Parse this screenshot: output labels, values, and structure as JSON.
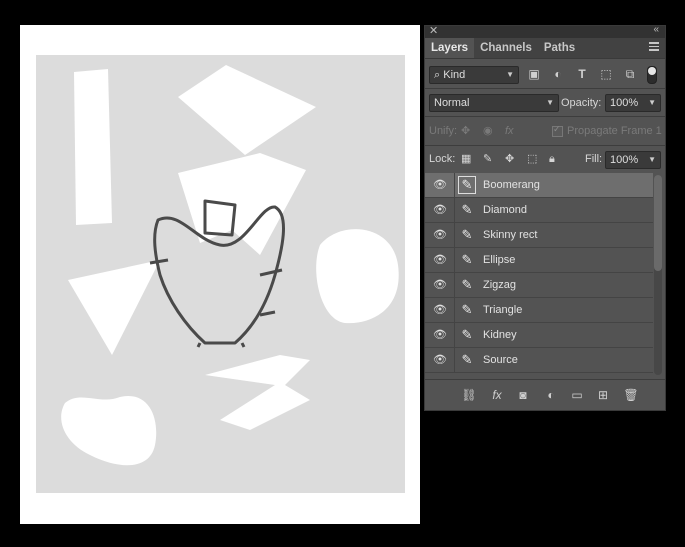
{
  "panel": {
    "tabs": [
      "Layers",
      "Channels",
      "Paths"
    ],
    "active_tab": "Layers",
    "filter": {
      "kind_label": "Kind"
    },
    "blend_mode": "Normal",
    "opacity_label": "Opacity:",
    "opacity_value": "100%",
    "unify_label": "Unify:",
    "propagate_label": "Propagate Frame 1",
    "lock_label": "Lock:",
    "fill_label": "Fill:",
    "fill_value": "100%",
    "layers": [
      {
        "name": "Boomerang",
        "selected": true
      },
      {
        "name": "Diamond",
        "selected": false
      },
      {
        "name": "Skinny rect",
        "selected": false
      },
      {
        "name": "Ellipse",
        "selected": false
      },
      {
        "name": "Zigzag",
        "selected": false
      },
      {
        "name": "Triangle",
        "selected": false
      },
      {
        "name": "Kidney",
        "selected": false
      },
      {
        "name": "Source",
        "selected": false
      }
    ],
    "bottom_icons": [
      "link-icon",
      "fx-icon",
      "mask-icon",
      "adjustment-icon",
      "folder-icon",
      "new-layer-icon",
      "trash-icon"
    ]
  }
}
